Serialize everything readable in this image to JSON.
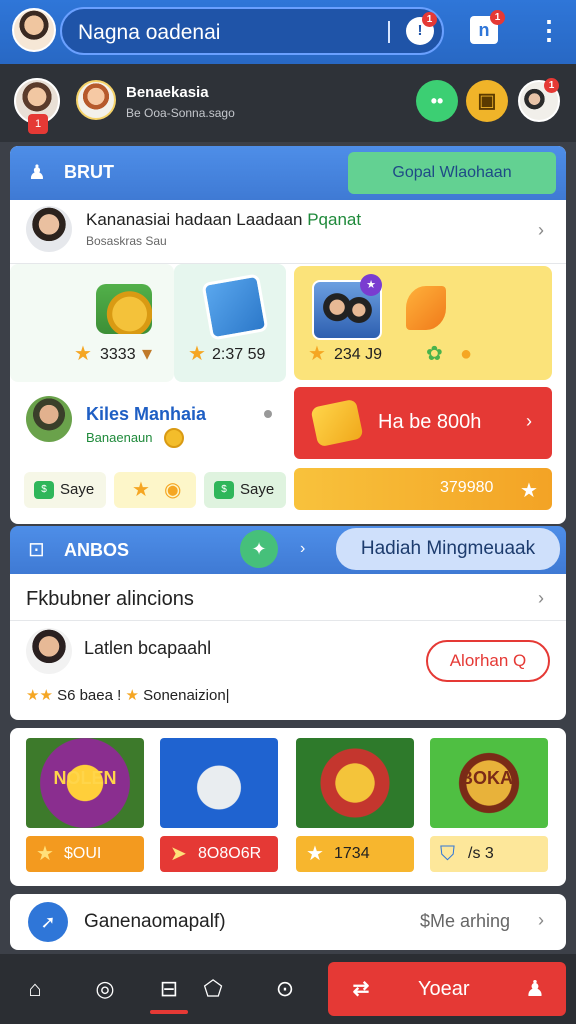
{
  "colors": {
    "brand_blue": "#2f76d8",
    "accent_red": "#e53935",
    "accent_green": "#63d192",
    "accent_yellow": "#fbe37a",
    "nav_bg": "#2b2e33"
  },
  "topbar": {
    "search_text": "Nagna oadenai",
    "mic_badge": "1",
    "news_badge": "1",
    "icons": [
      "avatar",
      "mic-icon",
      "news-icon",
      "more-vertical-icon"
    ]
  },
  "strip": {
    "name": "Benaekasia",
    "sub": "Be Ooa-Sonna.sago",
    "badge": "1"
  },
  "card1": {
    "header_title": "BRUT",
    "header_button": "Gopal Wlaohaan",
    "row_title_main": "Kananasiai hadaan Laadaan",
    "row_title_accent": "Pqanat",
    "row_sub": "Bosaskras Sau",
    "tiles": [
      {
        "value": "3333"
      },
      {
        "value": "2:37 59"
      },
      {
        "value": "234 J9"
      }
    ],
    "mid_title": "Kiles Manhaia",
    "mid_sub": "Banaenaun",
    "red_button": "Ha be 800h",
    "chips": [
      "Saye",
      "",
      "Saye"
    ],
    "orange_bar": "379980"
  },
  "section2": {
    "title": "ANBOS",
    "pill": "Hadiah Mingmeuaak"
  },
  "card2": {
    "title": "Fkbubner alincions",
    "name": "Latlen bcapaahl",
    "line_a": "S6 baea !",
    "line_b": "Sonenaizion|",
    "button": "Alorhan Q"
  },
  "games": [
    {
      "caption": "NOLEN",
      "pill": "$OUI"
    },
    {
      "caption": "",
      "pill": "8O8O6R"
    },
    {
      "caption": "",
      "pill": "1734"
    },
    {
      "caption": "BOKAI",
      "pill": "/s 3"
    }
  ],
  "card4": {
    "text": "Ganenaomapalf)",
    "right": "$Me arhing"
  },
  "nav": {
    "button_label": "Yoear"
  }
}
